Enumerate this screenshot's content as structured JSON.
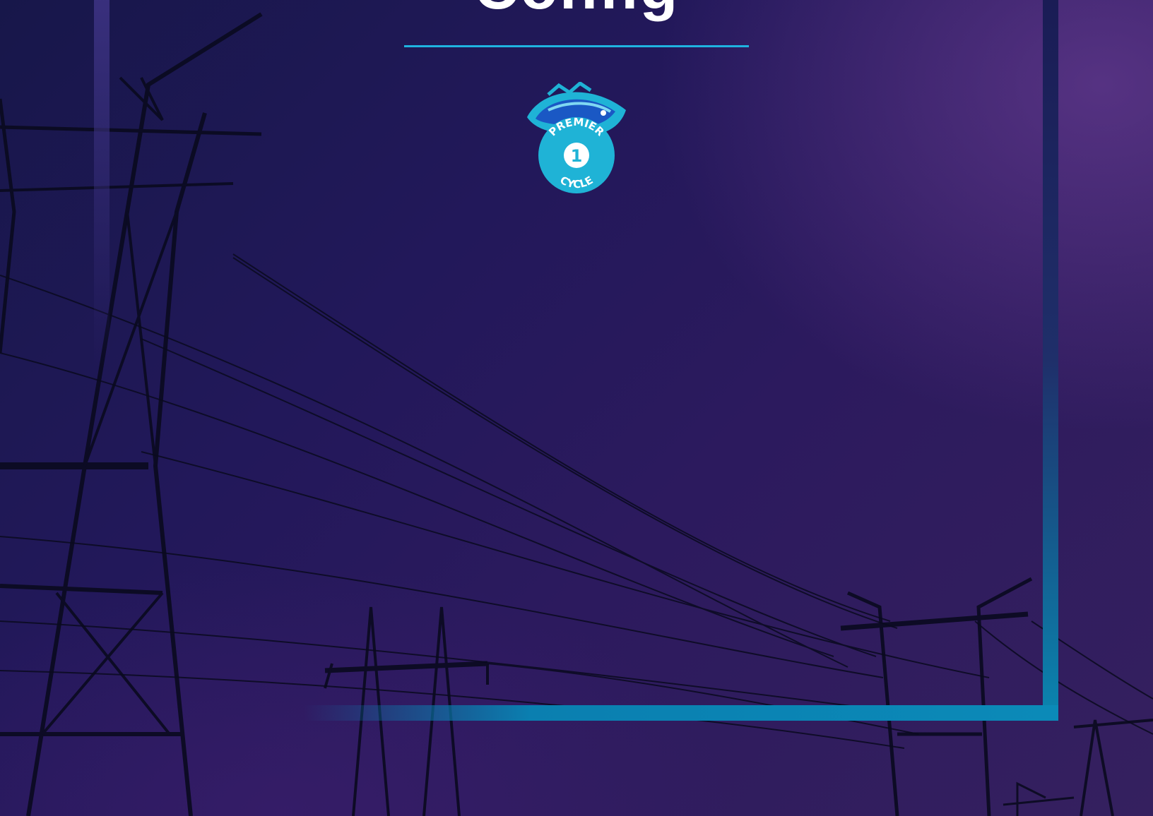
{
  "cover": {
    "title_partial": "Config",
    "rule_color": "#1fb3e0",
    "frame_color": "#0a86b0",
    "background_colors": [
      "#17174a",
      "#2c1a5e",
      "#35205f"
    ]
  },
  "logo": {
    "icon": "fish-badge-icon",
    "top_text": "PREMIER",
    "number": "1",
    "bottom_text": "CYCLE",
    "color": "#1fb3d6"
  },
  "background_image": {
    "icon": "power-line-towers-icon"
  }
}
